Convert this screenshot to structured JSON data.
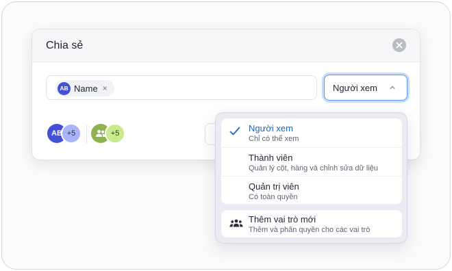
{
  "dialog": {
    "title": "Chia sẻ",
    "close_icon": "close-icon"
  },
  "invite": {
    "chip": {
      "initials": "AB",
      "label": "Name",
      "remove": "×"
    }
  },
  "role_select": {
    "selected": "Người xem",
    "icon": "chevron-up-icon"
  },
  "members": {
    "users": {
      "initials": "AB",
      "more": "+5"
    },
    "groups": {
      "icon": "group-icon",
      "more": "+5"
    }
  },
  "role_menu": {
    "items": [
      {
        "title": "Người xem",
        "description": "Chỉ có thể xem",
        "selected": true
      },
      {
        "title": "Thành viên",
        "description": "Quản lý cột, hàng và chỉnh sửa dữ liệu",
        "selected": false
      },
      {
        "title": "Quản trị viên",
        "description": "Có toàn quyền",
        "selected": false
      }
    ],
    "add_role": {
      "title": "Thêm vai trò mới",
      "description": "Thêm và phân quyền cho các vai trò",
      "icon": "group-add-icon"
    }
  },
  "colors": {
    "accent": "#1e64c8",
    "focus_ring": "#c9ddfa",
    "avatar_blue": "#4451d6",
    "avatar_green": "#8db24e"
  }
}
